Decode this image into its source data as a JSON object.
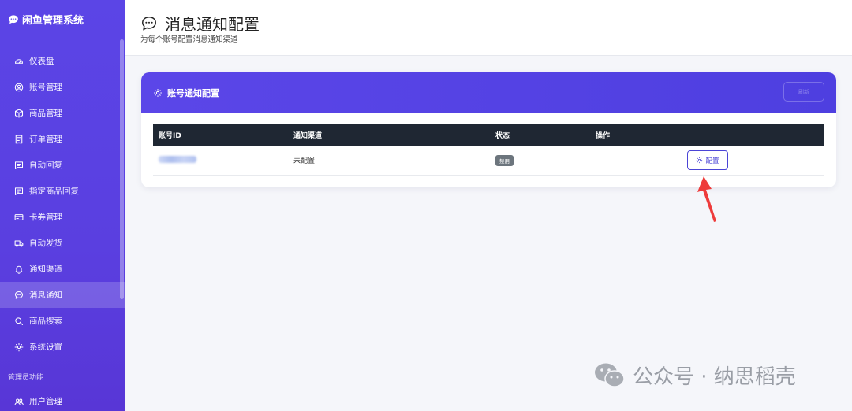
{
  "sidebar": {
    "brand": "闲鱼管理系统",
    "items": [
      {
        "label": "仪表盘",
        "icon": "dashboard-icon"
      },
      {
        "label": "账号管理",
        "icon": "user-circle-icon"
      },
      {
        "label": "商品管理",
        "icon": "box-icon"
      },
      {
        "label": "订单管理",
        "icon": "receipt-icon"
      },
      {
        "label": "自动回复",
        "icon": "message-icon"
      },
      {
        "label": "指定商品回复",
        "icon": "message-lines-icon"
      },
      {
        "label": "卡券管理",
        "icon": "card-icon"
      },
      {
        "label": "自动发货",
        "icon": "truck-icon"
      },
      {
        "label": "通知渠道",
        "icon": "bell-icon"
      },
      {
        "label": "消息通知",
        "icon": "chat-dots-icon",
        "active": true
      },
      {
        "label": "商品搜索",
        "icon": "search-icon"
      },
      {
        "label": "系统设置",
        "icon": "gear-icon"
      }
    ],
    "admin_section": "管理员功能",
    "admin_items": [
      {
        "label": "用户管理",
        "icon": "users-icon"
      }
    ]
  },
  "header": {
    "title": "消息通知配置",
    "subtitle": "为每个账号配置消息通知渠道"
  },
  "card": {
    "title": "账号通知配置",
    "refresh_label": "刷新",
    "columns": [
      "账号ID",
      "通知渠道",
      "状态",
      "操作"
    ],
    "rows": [
      {
        "channel": "未配置",
        "status": "禁用",
        "action": "配置"
      }
    ]
  },
  "watermark": {
    "text": "公众号 · 纳思稻壳"
  },
  "colors": {
    "accent": "#5b46e8",
    "table_header": "#1f2733",
    "badge_disabled": "#6c757d",
    "annotation_arrow": "#ee3b3b"
  }
}
